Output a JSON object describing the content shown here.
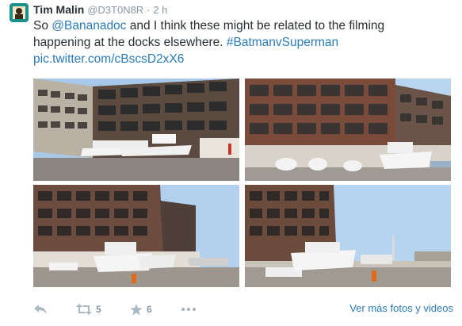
{
  "tweet": {
    "display_name": "Tim Malin",
    "handle": "@D3T0N8R",
    "separator": "·",
    "time": "2 h",
    "text": {
      "prefix": "So ",
      "mention": "@Bananadoc",
      "line1_rest": " and I think these might be related to the filming",
      "line2_text": "happening at the docks elsewhere. ",
      "hashtag": "#BatmanvSuperman",
      "media_link": "pic.twitter.com/cBscsD2xX6"
    },
    "photo_count": 4
  },
  "actions": {
    "reply_icon": "reply-icon",
    "retweet_icon": "retweet-icon",
    "retweet_count": "5",
    "favorite_icon": "star-icon",
    "favorite_count": "6",
    "more_icon": "more-dots-icon",
    "view_more_label": "Ver más fotos y videos"
  },
  "colors": {
    "link": "#2b7bb9",
    "text": "#292f33",
    "muted": "#8899a6",
    "icon": "#aab8c2"
  }
}
